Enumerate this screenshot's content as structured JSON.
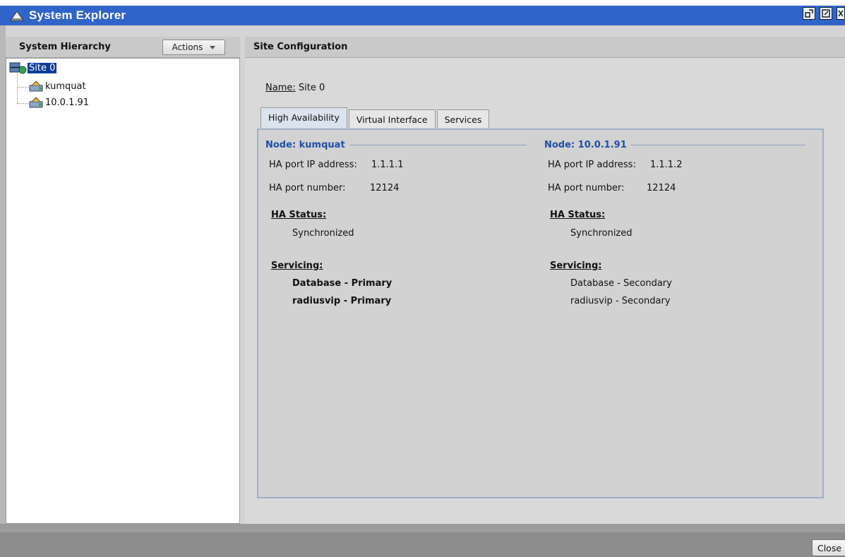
{
  "window": {
    "title": "System Explorer"
  },
  "left": {
    "header": "System Hierarchy",
    "actions_label": "Actions",
    "tree": [
      {
        "label": "Site 0",
        "selected": true
      },
      {
        "label": "kumquat"
      },
      {
        "label": "10.0.1.91"
      }
    ]
  },
  "right": {
    "header": "Site Configuration",
    "name_label": "Name:",
    "name_value": "Site 0",
    "tabs": [
      "High Availability",
      "Virtual Interface",
      "Services"
    ],
    "nodes": [
      {
        "title": "Node: kumquat",
        "ip_label": "HA port IP address:",
        "ip_value": "1.1.1.1",
        "port_label": "HA port number:",
        "port_value": "12124",
        "status_title": "HA Status:",
        "status_value": "Synchronized",
        "servicing_title": "Servicing:",
        "servicing": [
          "Database - Primary",
          "radiusvip - Primary"
        ]
      },
      {
        "title": "Node: 10.0.1.91",
        "ip_label": "HA port IP address:",
        "ip_value": "1.1.1.2",
        "port_label": "HA port number:",
        "port_value": "12124",
        "status_title": "HA Status:",
        "status_value": "Synchronized",
        "servicing_title": "Servicing:",
        "servicing": [
          "Database - Secondary",
          "radiusvip - Secondary"
        ]
      }
    ]
  },
  "footer": {
    "close_label": "Close"
  }
}
